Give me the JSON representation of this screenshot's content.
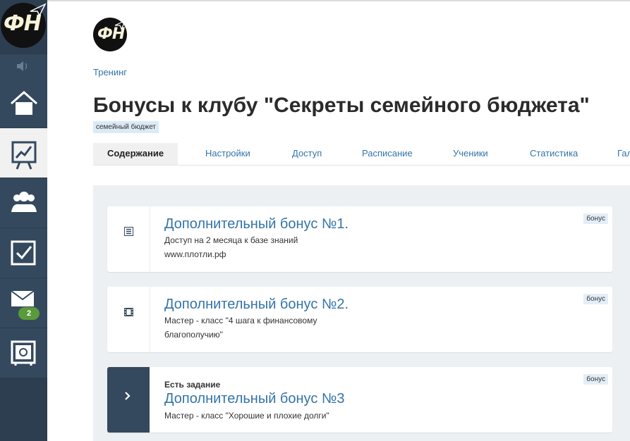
{
  "sidebar": {
    "logo_text": "ФН",
    "notifications_count": "2",
    "items": [
      {
        "name": "home",
        "icon": "home-icon"
      },
      {
        "name": "training",
        "icon": "chart-board-icon"
      },
      {
        "name": "users",
        "icon": "users-icon"
      },
      {
        "name": "tasks",
        "icon": "checkbox-icon"
      },
      {
        "name": "messages",
        "icon": "mail-icon"
      },
      {
        "name": "safe",
        "icon": "safe-icon"
      }
    ]
  },
  "header": {
    "logo_text": "ФН",
    "breadcrumb": "Тренинг",
    "title": "Бонусы к клубу \"Секреты семейного бюджета\"",
    "tag": "семейный бюджет"
  },
  "tabs": [
    {
      "label": "Содержание",
      "active": true
    },
    {
      "label": "Настройки"
    },
    {
      "label": "Доступ"
    },
    {
      "label": "Расписание"
    },
    {
      "label": "Ученики"
    },
    {
      "label": "Статистика"
    },
    {
      "label": "Гал"
    }
  ],
  "lessons": [
    {
      "icon": "list-icon",
      "title": "Дополнительный бонус №1.",
      "desc_line1": "Доступ на 2 месяца к базе знаний",
      "desc_line2": "www.плотли.рф",
      "badge": "бонус"
    },
    {
      "icon": "film-icon",
      "title": "Дополнительный бонус №2.",
      "desc_line1": "Мастер - класс \"4 шага к финансовому",
      "desc_line2": "благополучию\"",
      "badge": "бонус"
    },
    {
      "icon": "chevron-right-icon",
      "task_label": "Есть задание",
      "title": "Дополнительный бонус №3",
      "desc_line1": "Мастер - класс \"Хорошие и плохие долги\"",
      "badge": "бонус"
    }
  ],
  "colors": {
    "sidebar": "#34495e",
    "link": "#3474a8",
    "panel": "#edf0f3",
    "badge_green": "#5a9a3a"
  }
}
